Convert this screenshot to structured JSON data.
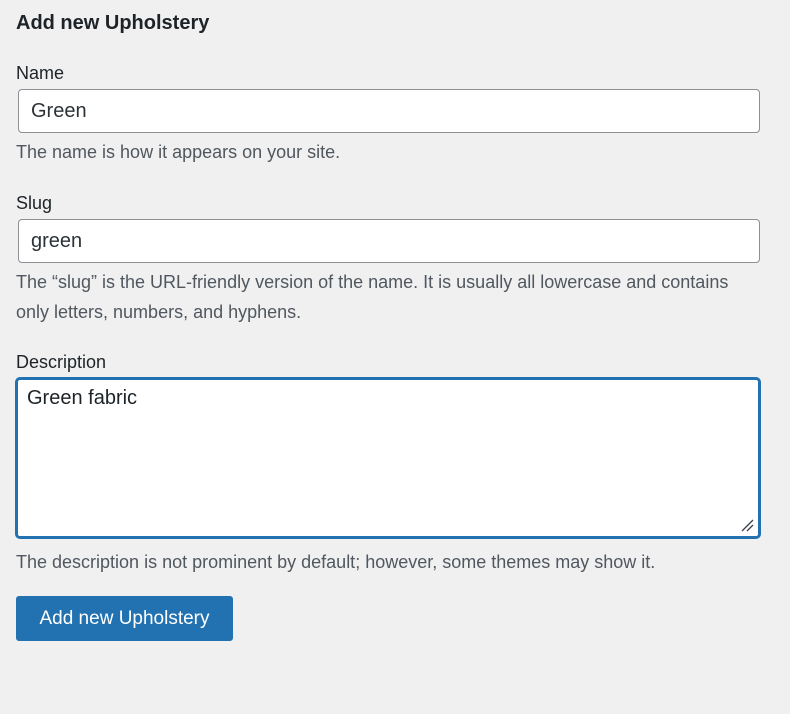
{
  "form": {
    "heading": "Add new Upholstery",
    "name": {
      "label": "Name",
      "value": "Green",
      "help": "The name is how it appears on your site."
    },
    "slug": {
      "label": "Slug",
      "value": "green",
      "help": "The “slug” is the URL-friendly version of the name. It is usually all lowercase and contains only letters, numbers, and hyphens."
    },
    "description": {
      "label": "Description",
      "value": "Green fabric",
      "help": "The description is not prominent by default; however, some themes may show it."
    },
    "submit_label": "Add new Upholstery"
  },
  "colors": {
    "background": "#f0f0f1",
    "accent": "#2271b1",
    "help_text": "#50575e",
    "input_border": "#8c8f94"
  }
}
